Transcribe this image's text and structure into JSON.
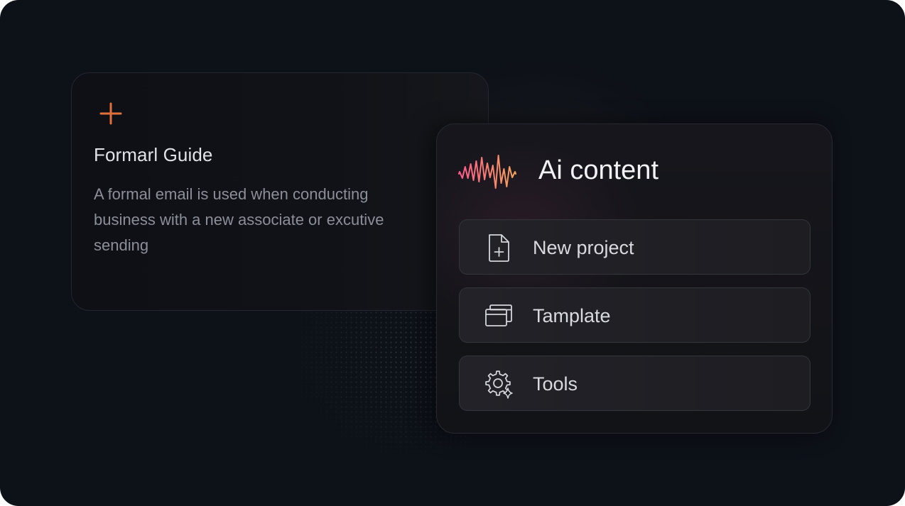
{
  "guide_card": {
    "title": "Formarl Guide",
    "description": "A formal email is used when conducting business with a new associate or excutive sending",
    "icon": "plus-icon",
    "accent_color": "#e2703a"
  },
  "ai_card": {
    "title": "Ai content",
    "logo_icon": "soundwave-icon",
    "logo_colors": [
      "#ff5a8a",
      "#f4a35c"
    ],
    "items": [
      {
        "label": "New project",
        "icon": "new-file-icon"
      },
      {
        "label": "Tamplate",
        "icon": "windows-stack-icon"
      },
      {
        "label": "Tools",
        "icon": "gear-sparkle-icon"
      }
    ]
  }
}
